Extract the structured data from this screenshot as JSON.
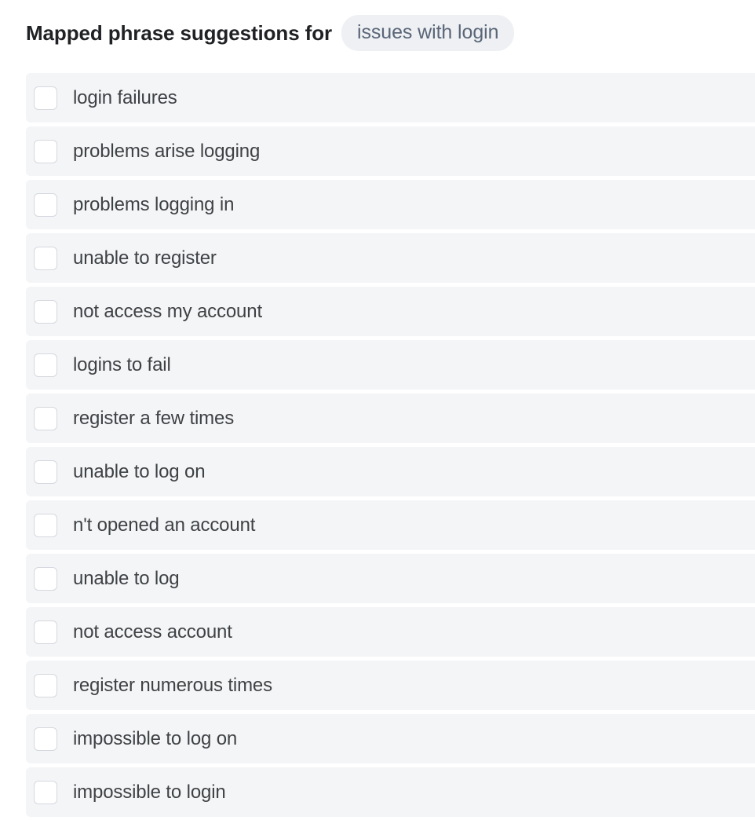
{
  "header": {
    "title": "Mapped phrase suggestions for",
    "query_pill": "issues with login",
    "pill_bg_color": "#eef0f3",
    "pill_text_color": "#5a6678",
    "title_color": "#1f2124"
  },
  "list": {
    "row_bg_color": "#f4f5f7",
    "label_color": "#3f4245",
    "checkbox_border_color": "#d5d8de",
    "items": [
      {
        "label": "login failures",
        "checked": false
      },
      {
        "label": "problems arise logging",
        "checked": false
      },
      {
        "label": "problems logging in",
        "checked": false
      },
      {
        "label": "unable to register",
        "checked": false
      },
      {
        "label": "not access my account",
        "checked": false
      },
      {
        "label": "logins to fail",
        "checked": false
      },
      {
        "label": "register a few times",
        "checked": false
      },
      {
        "label": "unable to log on",
        "checked": false
      },
      {
        "label": "n't opened an account",
        "checked": false
      },
      {
        "label": "unable to log",
        "checked": false
      },
      {
        "label": "not access account",
        "checked": false
      },
      {
        "label": "register numerous times",
        "checked": false
      },
      {
        "label": "impossible to log on",
        "checked": false
      },
      {
        "label": "impossible to login",
        "checked": false
      }
    ]
  }
}
